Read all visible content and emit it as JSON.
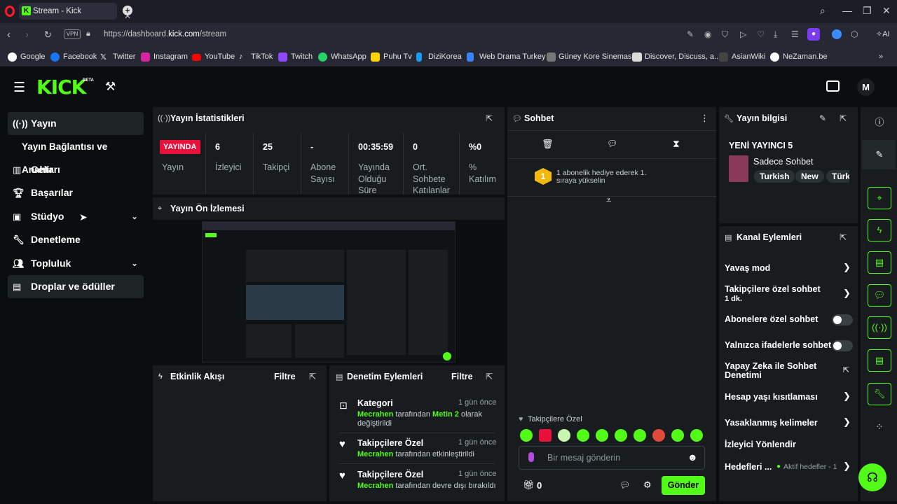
{
  "browser": {
    "tab_title": "Stream - Kick Dashboard",
    "tab_favicon": "K",
    "url_prefix": "https://dashboard.",
    "url_domain": "kick.com",
    "url_path": "/stream",
    "vpn_label": "VPN",
    "ai_label": "AI",
    "bookmarks": [
      "Google",
      "Facebook",
      "Twitter",
      "Instagram",
      "YouTube",
      "TikTok",
      "Twitch",
      "WhatsApp",
      "Puhu Tv",
      "DiziKorea",
      "Web Drama Turkey",
      "Güney Kore Sineması",
      "Discover, Discuss, a...",
      "AsianWiki",
      "NeZaman.be"
    ]
  },
  "kick": {
    "logo": "KICK",
    "beta": "BETA"
  },
  "sidebar": {
    "items": [
      {
        "label": "Yayın",
        "icon": "broadcast-icon"
      },
      {
        "label": "Yayın Bağlantısı ve Anahtarı"
      },
      {
        "label": "Gelir",
        "icon": "bar-chart-icon"
      },
      {
        "label": "Başarılar",
        "icon": "trophy-icon"
      },
      {
        "label": "Stüdyo",
        "icon": "studio-icon"
      },
      {
        "label": "Denetleme",
        "icon": "wrench-icon"
      },
      {
        "label": "Topluluk",
        "icon": "community-icon"
      },
      {
        "label": "Droplar ve ödüller",
        "icon": "drops-icon"
      }
    ]
  },
  "stats": {
    "title": "Yayın İstatistikleri",
    "live_badge": "YAYINDA",
    "live_label": "Yayın",
    "cells": [
      {
        "value": "6",
        "label": "İzleyici"
      },
      {
        "value": "25",
        "label": "Takipçi"
      },
      {
        "value": "-",
        "label": "Abone Sayısı"
      },
      {
        "value": "00:35:59",
        "label": "Yayında Olduğu Süre"
      },
      {
        "value": "0",
        "label": "Ort. Sohbete Katılanlar"
      },
      {
        "value": "%0",
        "label": "% Katılım"
      }
    ]
  },
  "preview": {
    "title": "Yayın Ön İzlemesi"
  },
  "activity": {
    "title": "Etkinlik Akışı",
    "filter": "Filtre"
  },
  "modlog": {
    "title": "Denetim Eylemleri",
    "filter": "Filtre",
    "events": [
      {
        "title": "Kategori",
        "time": "1 gün önce",
        "user": "Mecrahen",
        "mid": "tarafından",
        "highlight": "Metin 2",
        "rest": "olarak değiştirildi"
      },
      {
        "title": "Takipçilere Özel",
        "time": "1 gün önce",
        "user": "Mecrahen",
        "rest": "tarafından etkinleştirildi"
      },
      {
        "title": "Takipçilere Özel",
        "time": "1 gün önce",
        "user": "Mecrahen",
        "rest": "tarafından devre dışı bırakıldı"
      }
    ]
  },
  "chat": {
    "title": "Sohbet",
    "rank": "1",
    "promo": "1 abonelik hediye ederek 1. sıraya yükselin",
    "followers_only": "Takipçilere Özel",
    "placeholder": "Bir mesaj gönderin",
    "count": "0",
    "send": "Gönder"
  },
  "stream_info": {
    "title": "Yayın bilgisi",
    "stream_title": "YENİ YAYINCI 5",
    "category": "Sadece Sohbet",
    "tags": [
      "Turkish",
      "New",
      "Türk"
    ]
  },
  "channel_actions": {
    "title": "Kanal Eylemleri",
    "rows": [
      {
        "label": "Yavaş mod"
      },
      {
        "label": "Takipçilere özel sohbet",
        "sub": "1 dk."
      },
      {
        "label": "Abonelere özel sohbet"
      },
      {
        "label": "Yalnızca ifadelerle sohbet"
      },
      {
        "label": "Yapay Zeka ile Sohbet Denetimi"
      },
      {
        "label": "Hesap yaşı kısıtlaması"
      },
      {
        "label": "Yasaklanmış kelimeler"
      },
      {
        "label": "İzleyici Yönlendir"
      },
      {
        "label": "Hedefleri ...",
        "sub": "Aktif hedefler - 1"
      }
    ]
  },
  "colors": {
    "accent": "#53fc18",
    "live": "#e9113c",
    "panel": "#181c1f",
    "bg": "#0b0e0f"
  }
}
